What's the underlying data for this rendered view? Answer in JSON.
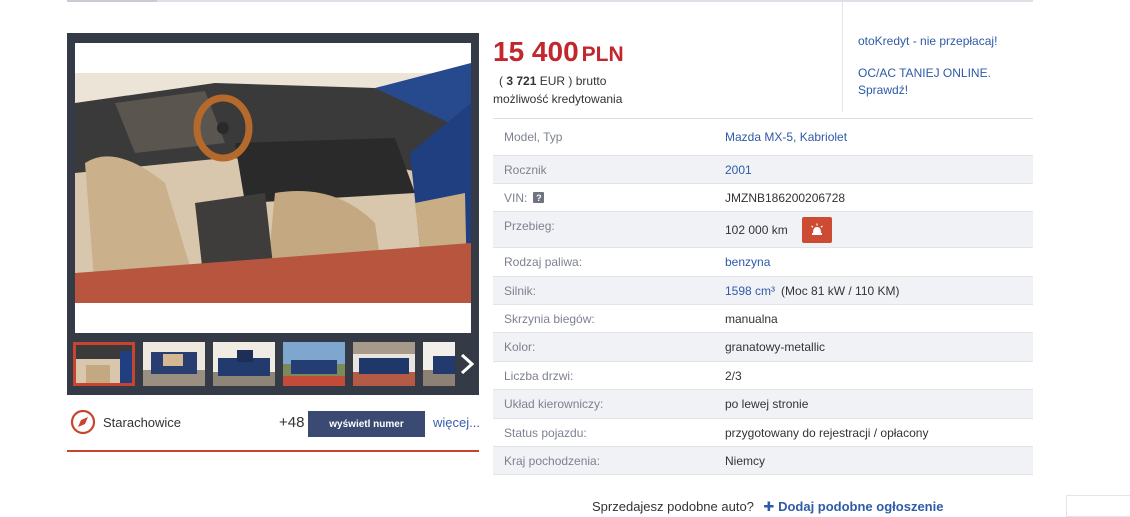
{
  "price": {
    "amount": "15 400",
    "currency": "PLN"
  },
  "price_eur": {
    "amount": "3 721",
    "currency": "EUR",
    "suffix": "brutto"
  },
  "credit_note": "możliwość kredytowania",
  "side_promo": {
    "link1": "otoKredyt - nie przepłacaj!",
    "link2_line1": "OC/AC TANIEJ ONLINE.",
    "link2_line2": "Sprawdź!"
  },
  "location": "Starachowice",
  "contact": {
    "phone_prefix": "+48",
    "show_number_label": "wyświetl numer",
    "more_label": "więcej..."
  },
  "gallery": {
    "next_icon": "chevron-right-icon",
    "thumbnail_count": 6,
    "active_thumbnail": 1
  },
  "params": [
    {
      "label": "Model, Typ",
      "value": "Mazda MX-5, Kabriolet",
      "link": true
    },
    {
      "label": "Rocznik",
      "value": "2001",
      "link": true
    },
    {
      "label": "VIN:",
      "value": "JMZNB186200206728",
      "link": false,
      "help_icon": "?"
    },
    {
      "label": "Przebieg:",
      "value": "102 000 km",
      "link": false,
      "action_icon": "report-icon"
    },
    {
      "label": "Rodzaj paliwa:",
      "value": "benzyna",
      "link": true
    },
    {
      "label": "Silnik:",
      "value": "1598 cm³",
      "extra": "(Moc 81 kW / 110 KM)",
      "link": true
    },
    {
      "label": "Skrzynia biegów:",
      "value": "manualna",
      "link": false
    },
    {
      "label": "Kolor:",
      "value": "granatowy-metallic",
      "link": false
    },
    {
      "label": "Liczba drzwi:",
      "value": "2/3",
      "link": false
    },
    {
      "label": "Układ kierowniczy:",
      "value": "po lewej stronie",
      "link": false
    },
    {
      "label": "Status pojazdu:",
      "value": "przygotowany do rejestracji / opłacony",
      "link": false
    },
    {
      "label": "Kraj pochodzenia:",
      "value": "Niemcy",
      "link": false
    }
  ],
  "sell_prompt": {
    "text": "Sprzedajesz podobne auto?",
    "add_label": "Dodaj podobne ogłoszenie"
  },
  "colors": {
    "price": "#c1272d",
    "link": "#2e5aa8",
    "accent": "#c8442e",
    "button": "#3a4a73",
    "gallery_bg": "#353a47"
  }
}
